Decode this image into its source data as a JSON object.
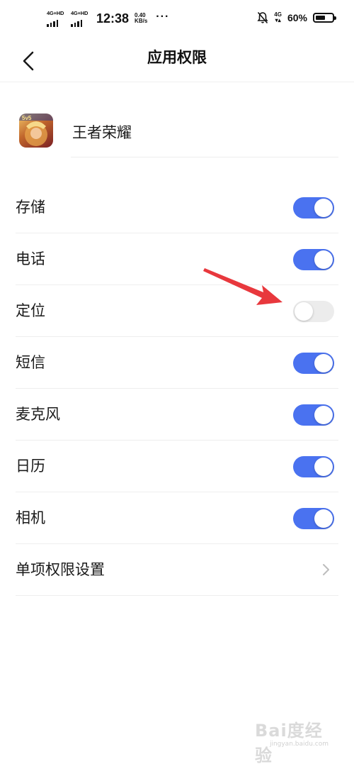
{
  "status_bar": {
    "sim1_label": "4G+HD",
    "sim2_label": "4G+HD",
    "time": "12:38",
    "speed_value": "0.40",
    "speed_unit": "KB/s",
    "more": "···",
    "network": "4G",
    "battery_text": "60%",
    "battery_level": 0.6
  },
  "header": {
    "title": "应用权限"
  },
  "app": {
    "name": "王者荣耀"
  },
  "permissions": [
    {
      "label": "存储",
      "enabled": true
    },
    {
      "label": "电话",
      "enabled": true
    },
    {
      "label": "定位",
      "enabled": false
    },
    {
      "label": "短信",
      "enabled": true
    },
    {
      "label": "麦克风",
      "enabled": true
    },
    {
      "label": "日历",
      "enabled": true
    },
    {
      "label": "相机",
      "enabled": true
    }
  ],
  "single_settings": {
    "label": "单项权限设置"
  },
  "colors": {
    "toggle_on": "#4a72f0",
    "toggle_off": "#ececec",
    "annotation_arrow": "#e8383d"
  },
  "watermark": {
    "text": "Bai度经验",
    "url": "jingyan.baidu.com"
  }
}
